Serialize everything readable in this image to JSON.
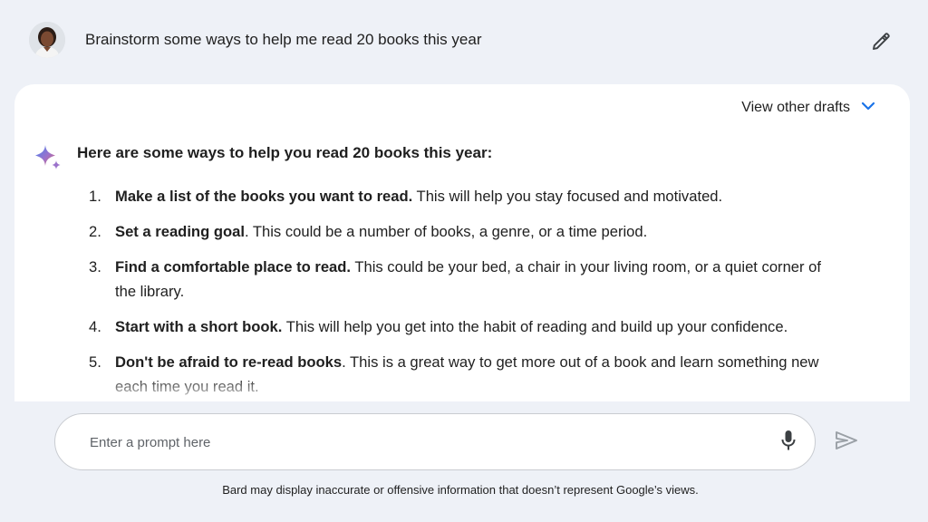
{
  "prompt": {
    "text": "Brainstorm some ways to help me read 20 books this year",
    "edit_icon": "pencil-icon"
  },
  "response": {
    "view_drafts_label": "View other drafts",
    "drafts_icon": "chevron-down-icon",
    "intro": "Here are some ways to help you read 20 books this year:",
    "items": [
      {
        "num": "1.",
        "bold": "Make a list of the books you want to read.",
        "rest": " This will help you stay focused and motivated."
      },
      {
        "num": "2.",
        "bold": "Set a reading goal",
        "rest": ". This could be a number of books, a genre, or a time period."
      },
      {
        "num": "3.",
        "bold": "Find a comfortable place to read.",
        "rest": " This could be your bed, a chair in your living room, or a quiet corner of the library."
      },
      {
        "num": "4.",
        "bold": "Start with a short book.",
        "rest": " This will help you get into the habit of reading and build up your confidence."
      },
      {
        "num": "5.",
        "bold": "Don't be afraid to re-read books",
        "rest": ". This is a great way to get more out of a book and learn something new each time you read it."
      }
    ]
  },
  "input": {
    "placeholder": "Enter a prompt here",
    "value": "",
    "mic_icon": "microphone-icon",
    "send_icon": "send-icon"
  },
  "footer": {
    "disclaimer": "Bard may display inaccurate or offensive information that doesn’t represent Google’s views."
  },
  "colors": {
    "background": "#eef1f7",
    "card": "#ffffff",
    "accent_blue": "#1a73e8",
    "sparkle_blue": "#4285f4",
    "sparkle_purple": "#9b72cb",
    "sparkle_pink": "#d96570"
  }
}
